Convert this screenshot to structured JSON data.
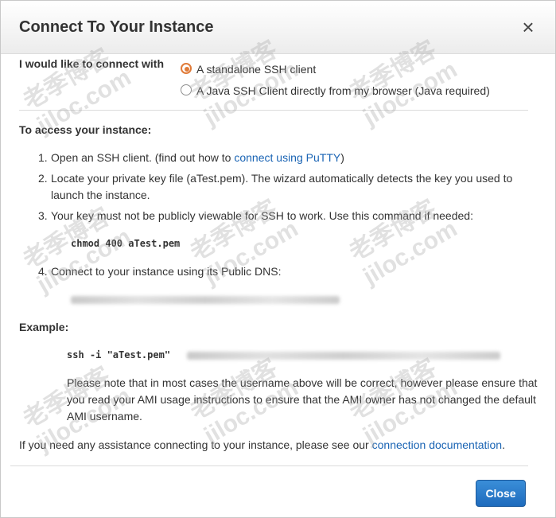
{
  "dialog": {
    "title": "Connect To Your Instance",
    "close_symbol": "×"
  },
  "connect": {
    "label": "I would like to connect with",
    "options": [
      {
        "label": "A standalone SSH client",
        "selected": true
      },
      {
        "label": "A Java SSH Client directly from my browser (Java required)",
        "selected": false
      }
    ]
  },
  "access": {
    "title": "To access your instance:",
    "steps": [
      {
        "num": "1.",
        "text": "Open an SSH client. (find out how to",
        "link": "connect using PuTTY",
        "after": ")"
      },
      {
        "num": "2.",
        "text": "Locate your private key file (aTest.pem). The wizard automatically detects the key you used to launch the instance."
      },
      {
        "num": "3.",
        "text": "Your key must not be publicly viewable for SSH to work. Use this command if needed:"
      },
      {
        "num": "4.",
        "text": "Connect to your instance using its Public DNS:"
      }
    ],
    "chmod_command": "chmod 400 aTest.pem"
  },
  "example": {
    "title": "Example:",
    "command": "ssh -i \"aTest.pem\"",
    "note": "Please note that in most cases the username above will be correct, however please ensure that you read your AMI usage instructions to ensure that the AMI owner has not changed the default AMI username."
  },
  "assistance": {
    "text": "If you need any assistance connecting to your instance, please see our",
    "link": "connection documentation",
    "after": "."
  },
  "footer": {
    "close_label": "Close"
  },
  "watermark": {
    "line1": "老季博客",
    "line2": "jiloc.com"
  },
  "colors": {
    "accent": "#1e6bbd",
    "radio_selected": "#e07b39",
    "link": "#1a64b4"
  }
}
